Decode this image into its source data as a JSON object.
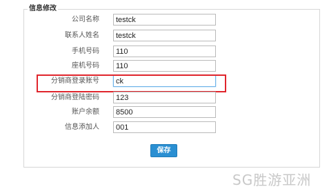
{
  "form": {
    "legend": "信息修改",
    "fields": [
      {
        "label": "公司名称",
        "value": "testck"
      },
      {
        "label": "联系人姓名",
        "value": "testck"
      },
      {
        "label": "手机号码",
        "value": "110"
      },
      {
        "label": "座机号码",
        "value": "110"
      },
      {
        "label": "分销商登录账号",
        "value": "ck"
      },
      {
        "label": "分销商登陆密码",
        "value": "123"
      },
      {
        "label": "账户余额",
        "value": "8500"
      },
      {
        "label": "信息添加人",
        "value": "001"
      }
    ],
    "save_label": "保存"
  },
  "watermark": "SG胜游亚洲",
  "colors": {
    "highlight": "#e0242b",
    "button": "#2a8fd2"
  }
}
